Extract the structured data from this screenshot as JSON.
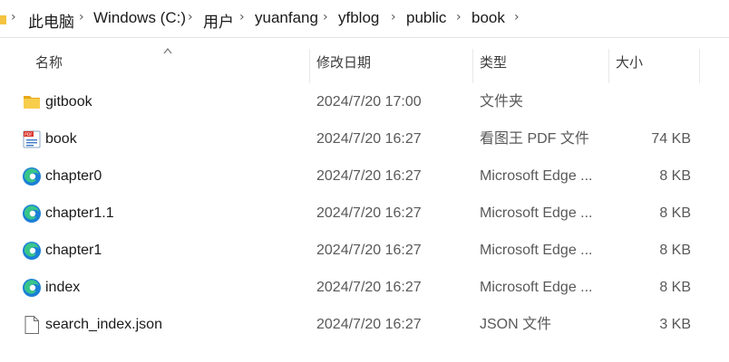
{
  "breadcrumb": [
    "此电脑",
    "Windows (C:)",
    "用户",
    "yuanfang",
    "yfblog",
    "public",
    "book"
  ],
  "columns": {
    "name": "名称",
    "modified": "修改日期",
    "type": "类型",
    "size": "大小"
  },
  "sort": {
    "column": "name",
    "direction": "ascending"
  },
  "files": [
    {
      "name": "gitbook",
      "modified": "2024/7/20 17:00",
      "type": "文件夹",
      "size": "",
      "icon": "folder-icon"
    },
    {
      "name": "book",
      "modified": "2024/7/20 16:27",
      "type": "看图王 PDF 文件",
      "size": "74 KB",
      "icon": "pdf-file-icon"
    },
    {
      "name": "chapter0",
      "modified": "2024/7/20 16:27",
      "type": "Microsoft Edge ...",
      "size": "8 KB",
      "icon": "edge-html-icon"
    },
    {
      "name": "chapter1.1",
      "modified": "2024/7/20 16:27",
      "type": "Microsoft Edge ...",
      "size": "8 KB",
      "icon": "edge-html-icon"
    },
    {
      "name": "chapter1",
      "modified": "2024/7/20 16:27",
      "type": "Microsoft Edge ...",
      "size": "8 KB",
      "icon": "edge-html-icon"
    },
    {
      "name": "index",
      "modified": "2024/7/20 16:27",
      "type": "Microsoft Edge ...",
      "size": "8 KB",
      "icon": "edge-html-icon"
    },
    {
      "name": "search_index.json",
      "modified": "2024/7/20 16:27",
      "type": "JSON 文件",
      "size": "3 KB",
      "icon": "json-file-icon"
    }
  ]
}
